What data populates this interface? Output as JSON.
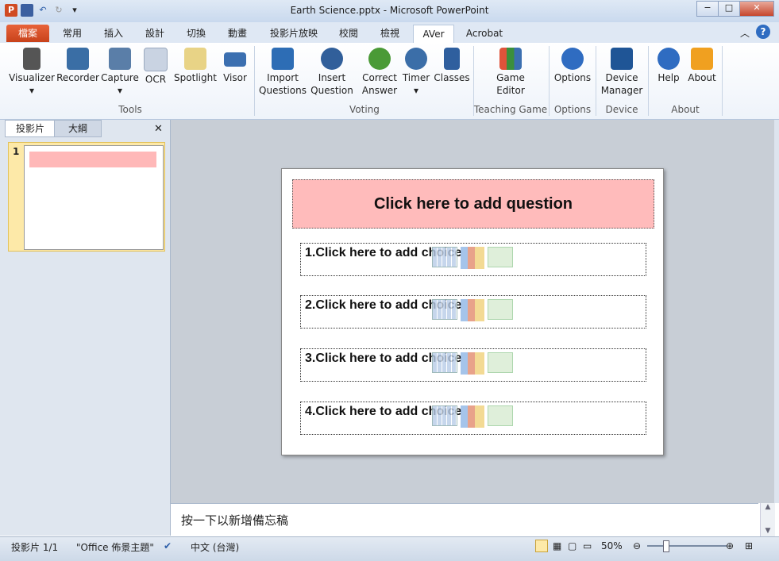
{
  "titlebar": {
    "title": "Earth Science.pptx - Microsoft PowerPoint",
    "min": "−",
    "max": "□",
    "close": "✕"
  },
  "tabs": [
    {
      "label": "檔案"
    },
    {
      "label": "常用"
    },
    {
      "label": "插入"
    },
    {
      "label": "設計"
    },
    {
      "label": "切換"
    },
    {
      "label": "動畫"
    },
    {
      "label": "投影片放映"
    },
    {
      "label": "校閱"
    },
    {
      "label": "檢視"
    },
    {
      "label": "AVer"
    },
    {
      "label": "Acrobat"
    }
  ],
  "ribbon": {
    "tools": [
      {
        "label": "Visualizer",
        "color": "#444"
      },
      {
        "label": "Recorder",
        "color": "#3a6ea5"
      },
      {
        "label": "Capture",
        "color": "#5a7ea8"
      },
      {
        "label": "OCR",
        "color": "#9aa9bf"
      },
      {
        "label": "Spotlight",
        "color": "#d9b23e"
      },
      {
        "label": "Visor",
        "color": "#3b6fb0"
      }
    ],
    "tools_group": "Tools",
    "voting": [
      {
        "label": "Import\nQuestions",
        "color": "#2d6db5"
      },
      {
        "label": "Insert\nQuestion",
        "color": "#315f9a"
      },
      {
        "label": "Correct\nAnswer",
        "color": "#4a9a36"
      },
      {
        "label": "Timer",
        "color": "#3b6ea8"
      },
      {
        "label": "Classes",
        "color": "#2f5f9e"
      }
    ],
    "voting_group": "Voting",
    "game": {
      "label": "Game\nEditor",
      "group": "Teaching Game"
    },
    "options": {
      "label": "Options",
      "group": "Options"
    },
    "device": {
      "label": "Device\nManager",
      "group": "Device"
    },
    "about": {
      "help": "Help",
      "about": "About",
      "group": "About"
    }
  },
  "left_pane": {
    "tab_slides": "投影片",
    "tab_outline": "大綱",
    "close": "✕",
    "thumb_num": "1"
  },
  "slide": {
    "question": "Click here to add question",
    "choices": [
      "1.Click here to add choice",
      "2.Click here to add choice",
      "3.Click here to add choice",
      "4.Click here to add choice"
    ]
  },
  "notes": {
    "placeholder": "按一下以新增備忘稿"
  },
  "status": {
    "slide_count": "投影片 1/1",
    "theme": "\"Office 佈景主題\"",
    "language": "中文 (台灣)",
    "zoom": "50%"
  }
}
